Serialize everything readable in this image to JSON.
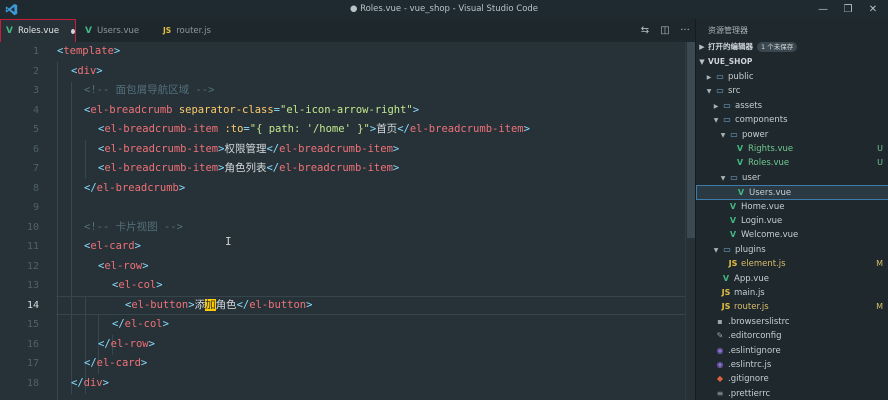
{
  "window": {
    "title": "● Roles.vue - vue_shop - Visual Studio Code",
    "controls": [
      "—",
      "❐",
      "✕"
    ]
  },
  "tabs": [
    {
      "label": "Roles.vue",
      "type": "vue",
      "active": true,
      "dirty": true
    },
    {
      "label": "Users.vue",
      "type": "vue",
      "active": false,
      "dirty": false
    },
    {
      "label": "router.js",
      "type": "js",
      "active": false,
      "dirty": false
    }
  ],
  "editor": {
    "line_numbers": [
      "1",
      "2",
      "3",
      "4",
      "5",
      "6",
      "7",
      "8",
      "9",
      "10",
      "11",
      "12",
      "13",
      "14",
      "15",
      "16",
      "17",
      "18"
    ],
    "current_line": "14",
    "code": {
      "l1": {
        "open": "<",
        "tag": "template",
        "close": ">"
      },
      "l2": {
        "open": "<",
        "tag": "div",
        "close": ">"
      },
      "l3": {
        "comment": "<!-- 面包屑导航区域 -->"
      },
      "l4": {
        "open": "<",
        "tag": "el-breadcrumb",
        "attr": "separator-class",
        "eq": "=",
        "val": "\"el-icon-arrow-right\"",
        "close": ">"
      },
      "l5": {
        "open": "<",
        "tag": "el-breadcrumb-item",
        "attr": ":to",
        "eq": "=",
        "val": "\"{ path: '/home' }\"",
        "close": ">",
        "text": "首页",
        "endopen": "</",
        "endtag": "el-breadcrumb-item",
        "endclose": ">"
      },
      "l6": {
        "open": "<",
        "tag": "el-breadcrumb-item",
        "close": ">",
        "text": "权限管理",
        "endopen": "</",
        "endtag": "el-breadcrumb-item",
        "endclose": ">"
      },
      "l7": {
        "open": "<",
        "tag": "el-breadcrumb-item",
        "close": ">",
        "text": "角色列表",
        "endopen": "</",
        "endtag": "el-breadcrumb-item",
        "endclose": ">"
      },
      "l8": {
        "open": "</",
        "tag": "el-breadcrumb",
        "close": ">"
      },
      "l10": {
        "comment": "<!-- 卡片视图 -->"
      },
      "l11": {
        "open": "<",
        "tag": "el-card",
        "close": ">"
      },
      "l12": {
        "open": "<",
        "tag": "el-row",
        "close": ">"
      },
      "l13": {
        "open": "<",
        "tag": "el-col",
        "close": ">"
      },
      "l14": {
        "open": "<",
        "tag": "el-button",
        "close": ">",
        "text_a": "添",
        "text_b": "加",
        "text_c": "角色",
        "endopen": "</",
        "endtag": "el-button",
        "endclose": ">"
      },
      "l15": {
        "open": "</",
        "tag": "el-col",
        "close": ">"
      },
      "l16": {
        "open": "</",
        "tag": "el-row",
        "close": ">"
      },
      "l17": {
        "open": "</",
        "tag": "el-card",
        "close": ">"
      },
      "l18": {
        "open": "</",
        "tag": "div",
        "close": ">"
      }
    }
  },
  "sidebar": {
    "title": "资源管理器",
    "open_editors": {
      "label": "打开的编辑器",
      "badge": "1 个未保存"
    },
    "project": {
      "label": "VUE_SHOP"
    },
    "tree": [
      {
        "name": "public",
        "kind": "folder",
        "expanded": false,
        "status": ""
      },
      {
        "name": "src",
        "kind": "folder",
        "expanded": true,
        "status": ""
      },
      {
        "name": "assets",
        "kind": "folder",
        "expanded": false,
        "status": ""
      },
      {
        "name": "components",
        "kind": "folder",
        "expanded": true,
        "status": ""
      },
      {
        "name": "power",
        "kind": "folder",
        "expanded": true,
        "status": ""
      },
      {
        "name": "Rights.vue",
        "kind": "vue",
        "status": "U"
      },
      {
        "name": "Roles.vue",
        "kind": "vue",
        "status": "U"
      },
      {
        "name": "user",
        "kind": "folder",
        "expanded": true,
        "status": ""
      },
      {
        "name": "Users.vue",
        "kind": "vue",
        "status": ""
      },
      {
        "name": "Home.vue",
        "kind": "vue",
        "status": ""
      },
      {
        "name": "Login.vue",
        "kind": "vue",
        "status": ""
      },
      {
        "name": "Welcome.vue",
        "kind": "vue",
        "status": ""
      },
      {
        "name": "plugins",
        "kind": "folder",
        "expanded": true,
        "status": ""
      },
      {
        "name": "element.js",
        "kind": "js",
        "status": "M"
      },
      {
        "name": "App.vue",
        "kind": "vue",
        "status": ""
      },
      {
        "name": "main.js",
        "kind": "js",
        "status": ""
      },
      {
        "name": "router.js",
        "kind": "js",
        "status": "M"
      },
      {
        "name": ".browserslistrc",
        "kind": "cfg",
        "status": ""
      },
      {
        "name": ".editorconfig",
        "kind": "cfg2",
        "status": ""
      },
      {
        "name": ".eslintignore",
        "kind": "purple",
        "status": ""
      },
      {
        "name": ".eslintrc.js",
        "kind": "purple",
        "status": ""
      },
      {
        "name": ".gitignore",
        "kind": "git",
        "status": ""
      },
      {
        "name": ".prettierrc",
        "kind": "cfg",
        "status": ""
      }
    ]
  },
  "colors": {
    "accent_active_tab": "#c81c3a",
    "editor_bg": "#263238",
    "tag": "#f07178",
    "attribute": "#ffcb6b",
    "string": "#c3e88d",
    "comment": "#546e7a"
  }
}
